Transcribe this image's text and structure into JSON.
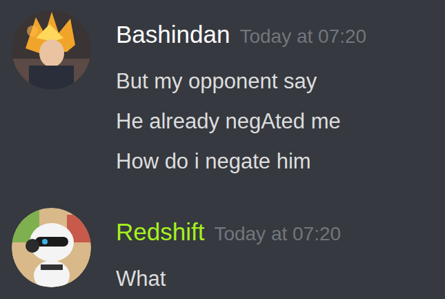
{
  "messages": [
    {
      "author": "Bashindan",
      "color": "#ffffff",
      "time": "Today at 07:20",
      "lines": [
        "But my opponent say",
        "He already negAted me",
        "How do i negate him"
      ]
    },
    {
      "author": "Redshift",
      "color": "#a6f01f",
      "time": "Today at 07:20",
      "lines": [
        "What"
      ]
    }
  ]
}
